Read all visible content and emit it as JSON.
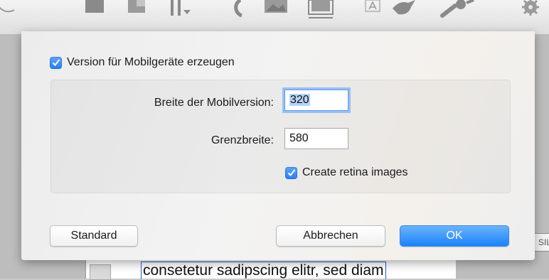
{
  "background": {
    "document_text": "consetetur sadipscing elitr, sed diam",
    "side_button_label": "SIL",
    "toolbar_icons": [
      "layout-icon",
      "layout-icon",
      "text-cursor-icon",
      "undo-icon",
      "image-icon",
      "frame-icon",
      "text-icon",
      "bird-icon",
      "wrench-icon",
      "gear-icon"
    ]
  },
  "dialog": {
    "mobile_version": {
      "label": "Version für Mobilgeräte erzeugen",
      "checked": true
    },
    "mobile_width": {
      "label": "Breite der Mobilversion:",
      "value": "320"
    },
    "breakpoint_width": {
      "label": "Grenzbreite:",
      "value": "580"
    },
    "retina": {
      "label": "Create retina images",
      "checked": true
    },
    "buttons": {
      "default_label": "Standard",
      "cancel_label": "Abbrechen",
      "ok_label": "OK"
    }
  },
  "colors": {
    "accent": "#1a82fb",
    "dialog_background": "#f0f0f0"
  }
}
